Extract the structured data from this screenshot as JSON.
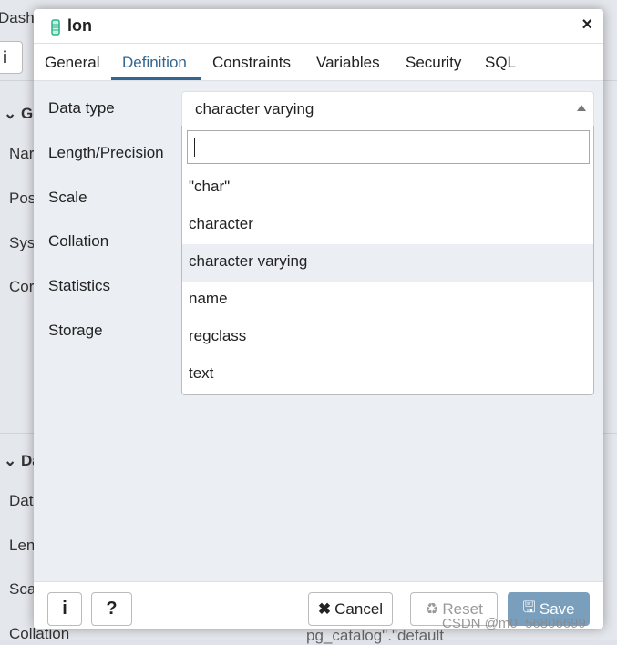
{
  "background": {
    "texts": [
      "Dashb",
      "Ge",
      "Nar",
      "Pos",
      "Sys",
      "Cor",
      "Da",
      "Dat",
      "Len",
      "Sca",
      "Collation",
      "pg_catalog\".\"default"
    ]
  },
  "dialog": {
    "title": "lon",
    "close_icon": "×"
  },
  "tabs": [
    "General",
    "Definition",
    "Constraints",
    "Variables",
    "Security",
    "SQL"
  ],
  "active_tab": "Definition",
  "form": {
    "labels": [
      "Data type",
      "Length/Precision",
      "Scale",
      "Collation",
      "Statistics",
      "Storage"
    ]
  },
  "data_type": {
    "value": "character varying",
    "search_value": "",
    "options": [
      "\"char\"",
      "character",
      "character varying",
      "name",
      "regclass",
      "text"
    ],
    "highlighted": "character varying"
  },
  "footer": {
    "info": "i",
    "help": "?",
    "cancel": "Cancel",
    "reset": "Reset",
    "save": "Save"
  },
  "colors": {
    "accent": "#326690",
    "save": "#7a9fbd"
  },
  "watermark": "CSDN @m0_56806699"
}
